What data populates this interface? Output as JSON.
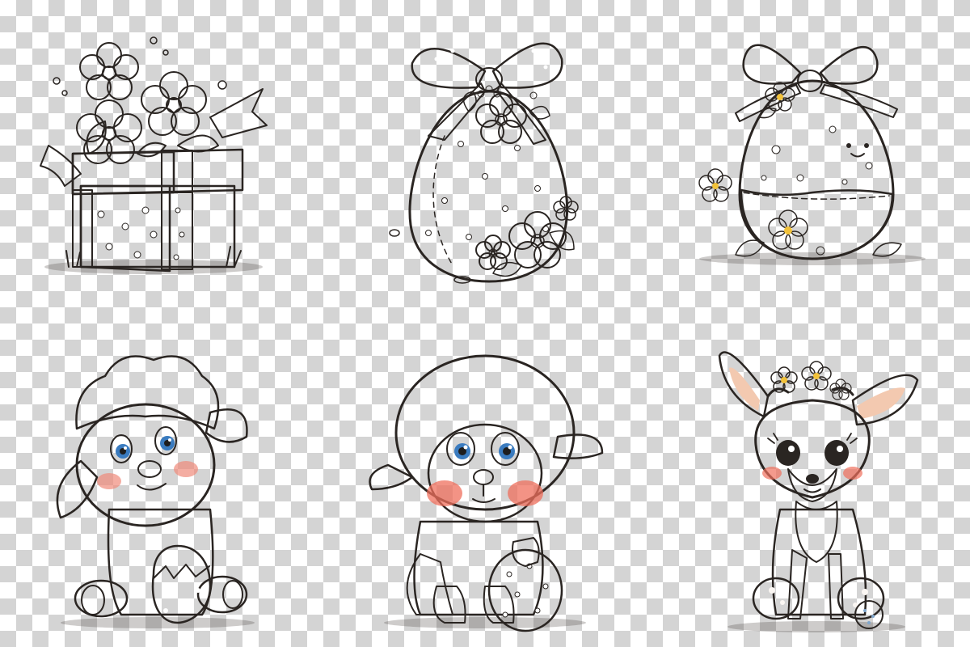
{
  "palette": {
    "ink": "#2a2522",
    "egg_orange": "#e88a4a",
    "egg_red": "#e2573e",
    "ribbon_red": "#d9505a",
    "bow_blue": "#7fb3de",
    "flower_blue": "#6aa6dc",
    "flower_orange": "#f2a23a",
    "flower_pink": "#e9a6bd",
    "leaf_green": "#5e9c4e",
    "fur_white": "#f2efea",
    "fur_grey": "#9a9a9a",
    "fawn_orange": "#e98b3f",
    "cream": "#f6ead8"
  },
  "illustrations": [
    {
      "id": "gift-box",
      "subject": "gift-box-with-flowers-icon"
    },
    {
      "id": "egg-bow-orange",
      "subject": "decorated-easter-egg-icon"
    },
    {
      "id": "egg-face-red",
      "subject": "smiling-easter-egg-icon"
    },
    {
      "id": "lamb-white",
      "subject": "white-lamb-icon"
    },
    {
      "id": "lamb-grey",
      "subject": "grey-lamb-icon"
    },
    {
      "id": "fawn",
      "subject": "fawn-icon"
    }
  ]
}
